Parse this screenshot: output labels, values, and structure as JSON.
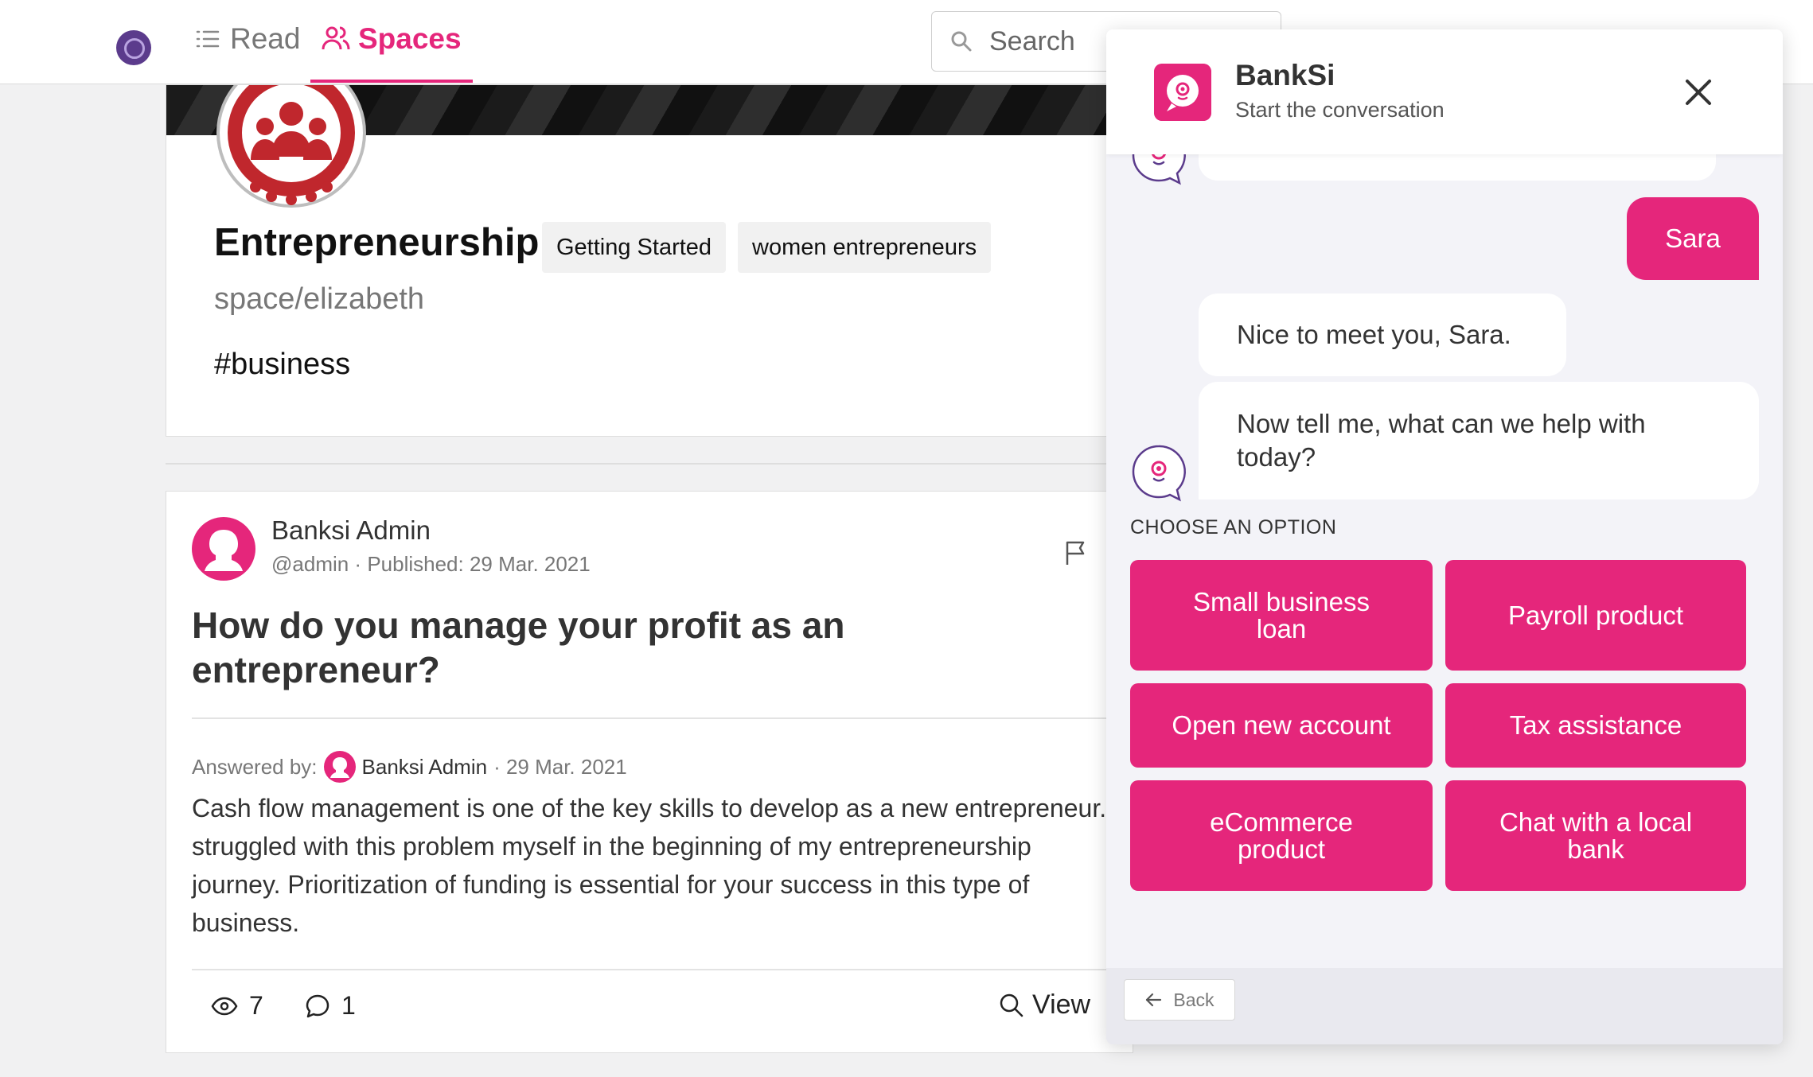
{
  "nav": {
    "read_label": "Read",
    "spaces_label": "Spaces",
    "search_placeholder": "Search"
  },
  "space": {
    "title": "Entrepreneurship",
    "tags": [
      "Getting Started",
      "women entrepreneurs"
    ],
    "path": "space/elizabeth",
    "hashtag": "#business"
  },
  "post": {
    "author_name": "Banksi Admin",
    "author_meta": "@admin · Published: 29 Mar. 2021",
    "title": "How do you manage your profit as an entrepreneur?",
    "answered_label": "Answered by:",
    "answer_author": "Banksi Admin",
    "answer_date": "· 29 Mar. 2021",
    "body": "Cash flow management is one of the key skills to develop as a new entrepreneur. I struggled with this problem myself in the beginning of my entrepreneurship journey. Prioritization of funding is essential for your success in this type of business.",
    "views": "7",
    "comments": "1",
    "view_label": "View"
  },
  "chat": {
    "bot_name": "BankSi",
    "subtitle": "Start the conversation",
    "user_message": "Sara",
    "bot_message_1": "Nice to meet you, Sara.",
    "bot_message_2": "Now tell me, what can we help with today?",
    "choose_label": "CHOOSE AN OPTION",
    "options": [
      "Small business loan",
      "Payroll product",
      "Open new account",
      "Tax assistance",
      "eCommerce product",
      "Chat with a local bank"
    ],
    "back_label": "Back"
  },
  "colors": {
    "accent": "#e5267b",
    "space_icon": "#c0272d"
  }
}
